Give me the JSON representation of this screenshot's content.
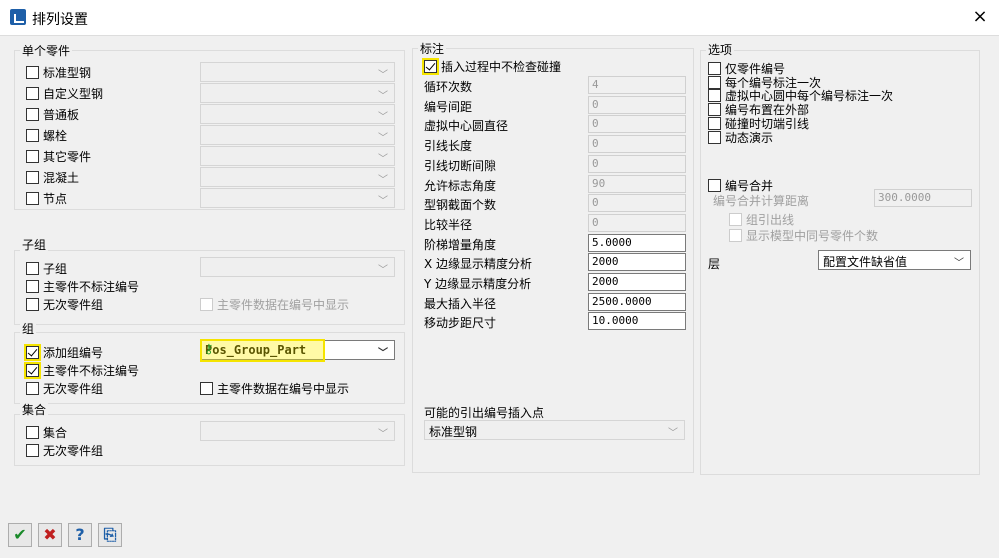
{
  "window": {
    "title": "排列设置",
    "close_icon": "×"
  },
  "single_parts": {
    "title": "单个零件",
    "items": [
      {
        "label": "标准型钢",
        "checked": false
      },
      {
        "label": "自定义型钢",
        "checked": false
      },
      {
        "label": "普通板",
        "checked": false
      },
      {
        "label": "螺栓",
        "checked": false
      },
      {
        "label": "其它零件",
        "checked": false
      },
      {
        "label": "混凝土",
        "checked": false
      },
      {
        "label": "节点",
        "checked": false
      }
    ]
  },
  "subgroup": {
    "title": "子组",
    "items": [
      {
        "label": "子组",
        "checked": false
      },
      {
        "label": "主零件不标注编号",
        "checked": false
      },
      {
        "label": "无次零件组",
        "checked": false
      }
    ],
    "show_main": "主零件数据在编号中显示"
  },
  "group": {
    "title": "组",
    "items": [
      {
        "label": "添加组编号",
        "checked": true
      },
      {
        "label": "主零件不标注编号",
        "checked": true
      },
      {
        "label": "无次零件组",
        "checked": false
      }
    ],
    "combo_value": "Pos_Group_Part",
    "show_main": "主零件数据在编号中显示"
  },
  "assembly": {
    "title": "集合",
    "items": [
      {
        "label": "集合",
        "checked": false
      },
      {
        "label": "无次零件组",
        "checked": false
      }
    ]
  },
  "annotation": {
    "title": "标注",
    "no_collision": "插入过程中不检查碰撞",
    "fields": [
      {
        "label": "循环次数",
        "value": "4",
        "enabled": false
      },
      {
        "label": "编号间距",
        "value": "0",
        "enabled": false
      },
      {
        "label": "虚拟中心圆直径",
        "value": "0",
        "enabled": false
      },
      {
        "label": "引线长度",
        "value": "0",
        "enabled": false
      },
      {
        "label": "引线切断间隙",
        "value": "0",
        "enabled": false
      },
      {
        "label": "允许标志角度",
        "value": "90",
        "enabled": false
      },
      {
        "label": "型钢截面个数",
        "value": "0",
        "enabled": false
      },
      {
        "label": "比较半径",
        "value": "0",
        "enabled": false
      },
      {
        "label": "阶梯增量角度",
        "value": "5.0000",
        "enabled": true
      },
      {
        "label": "X 边缘显示精度分析",
        "value": "2000",
        "enabled": true
      },
      {
        "label": "Y 边缘显示精度分析",
        "value": "2000",
        "enabled": true
      },
      {
        "label": "最大插入半径",
        "value": "2500.0000",
        "enabled": true
      },
      {
        "label": "移动步距尺寸",
        "value": "10.0000",
        "enabled": true
      }
    ],
    "insert_point_label": "可能的引出编号插入点",
    "insert_point_value": "标准型钢"
  },
  "options": {
    "title": "选项",
    "items": [
      {
        "label": "仅零件编号"
      },
      {
        "label": "每个编号标注一次"
      },
      {
        "label": "虚拟中心圆中每个编号标注一次"
      },
      {
        "label": "编号布置在外部"
      },
      {
        "label": "碰撞时切端引线"
      },
      {
        "label": "动态演示"
      }
    ],
    "merge": "编号合并",
    "merge_distance_label": "编号合并计算距离",
    "merge_distance": "300.0000",
    "group_leader": "组引出线",
    "show_count": "显示模型中同号零件个数",
    "layer_label": "层",
    "layer_value": "配置文件缺省值"
  },
  "buttons": [
    {
      "name": "ok-button",
      "icon": "✔",
      "color": "#1a8a2a"
    },
    {
      "name": "cancel-button",
      "icon": "✖",
      "color": "#c02020"
    },
    {
      "name": "help-button",
      "icon": "?",
      "color": "#1e5fa8"
    },
    {
      "name": "export-button",
      "icon": "⎘",
      "color": "#1e5fa8"
    }
  ]
}
